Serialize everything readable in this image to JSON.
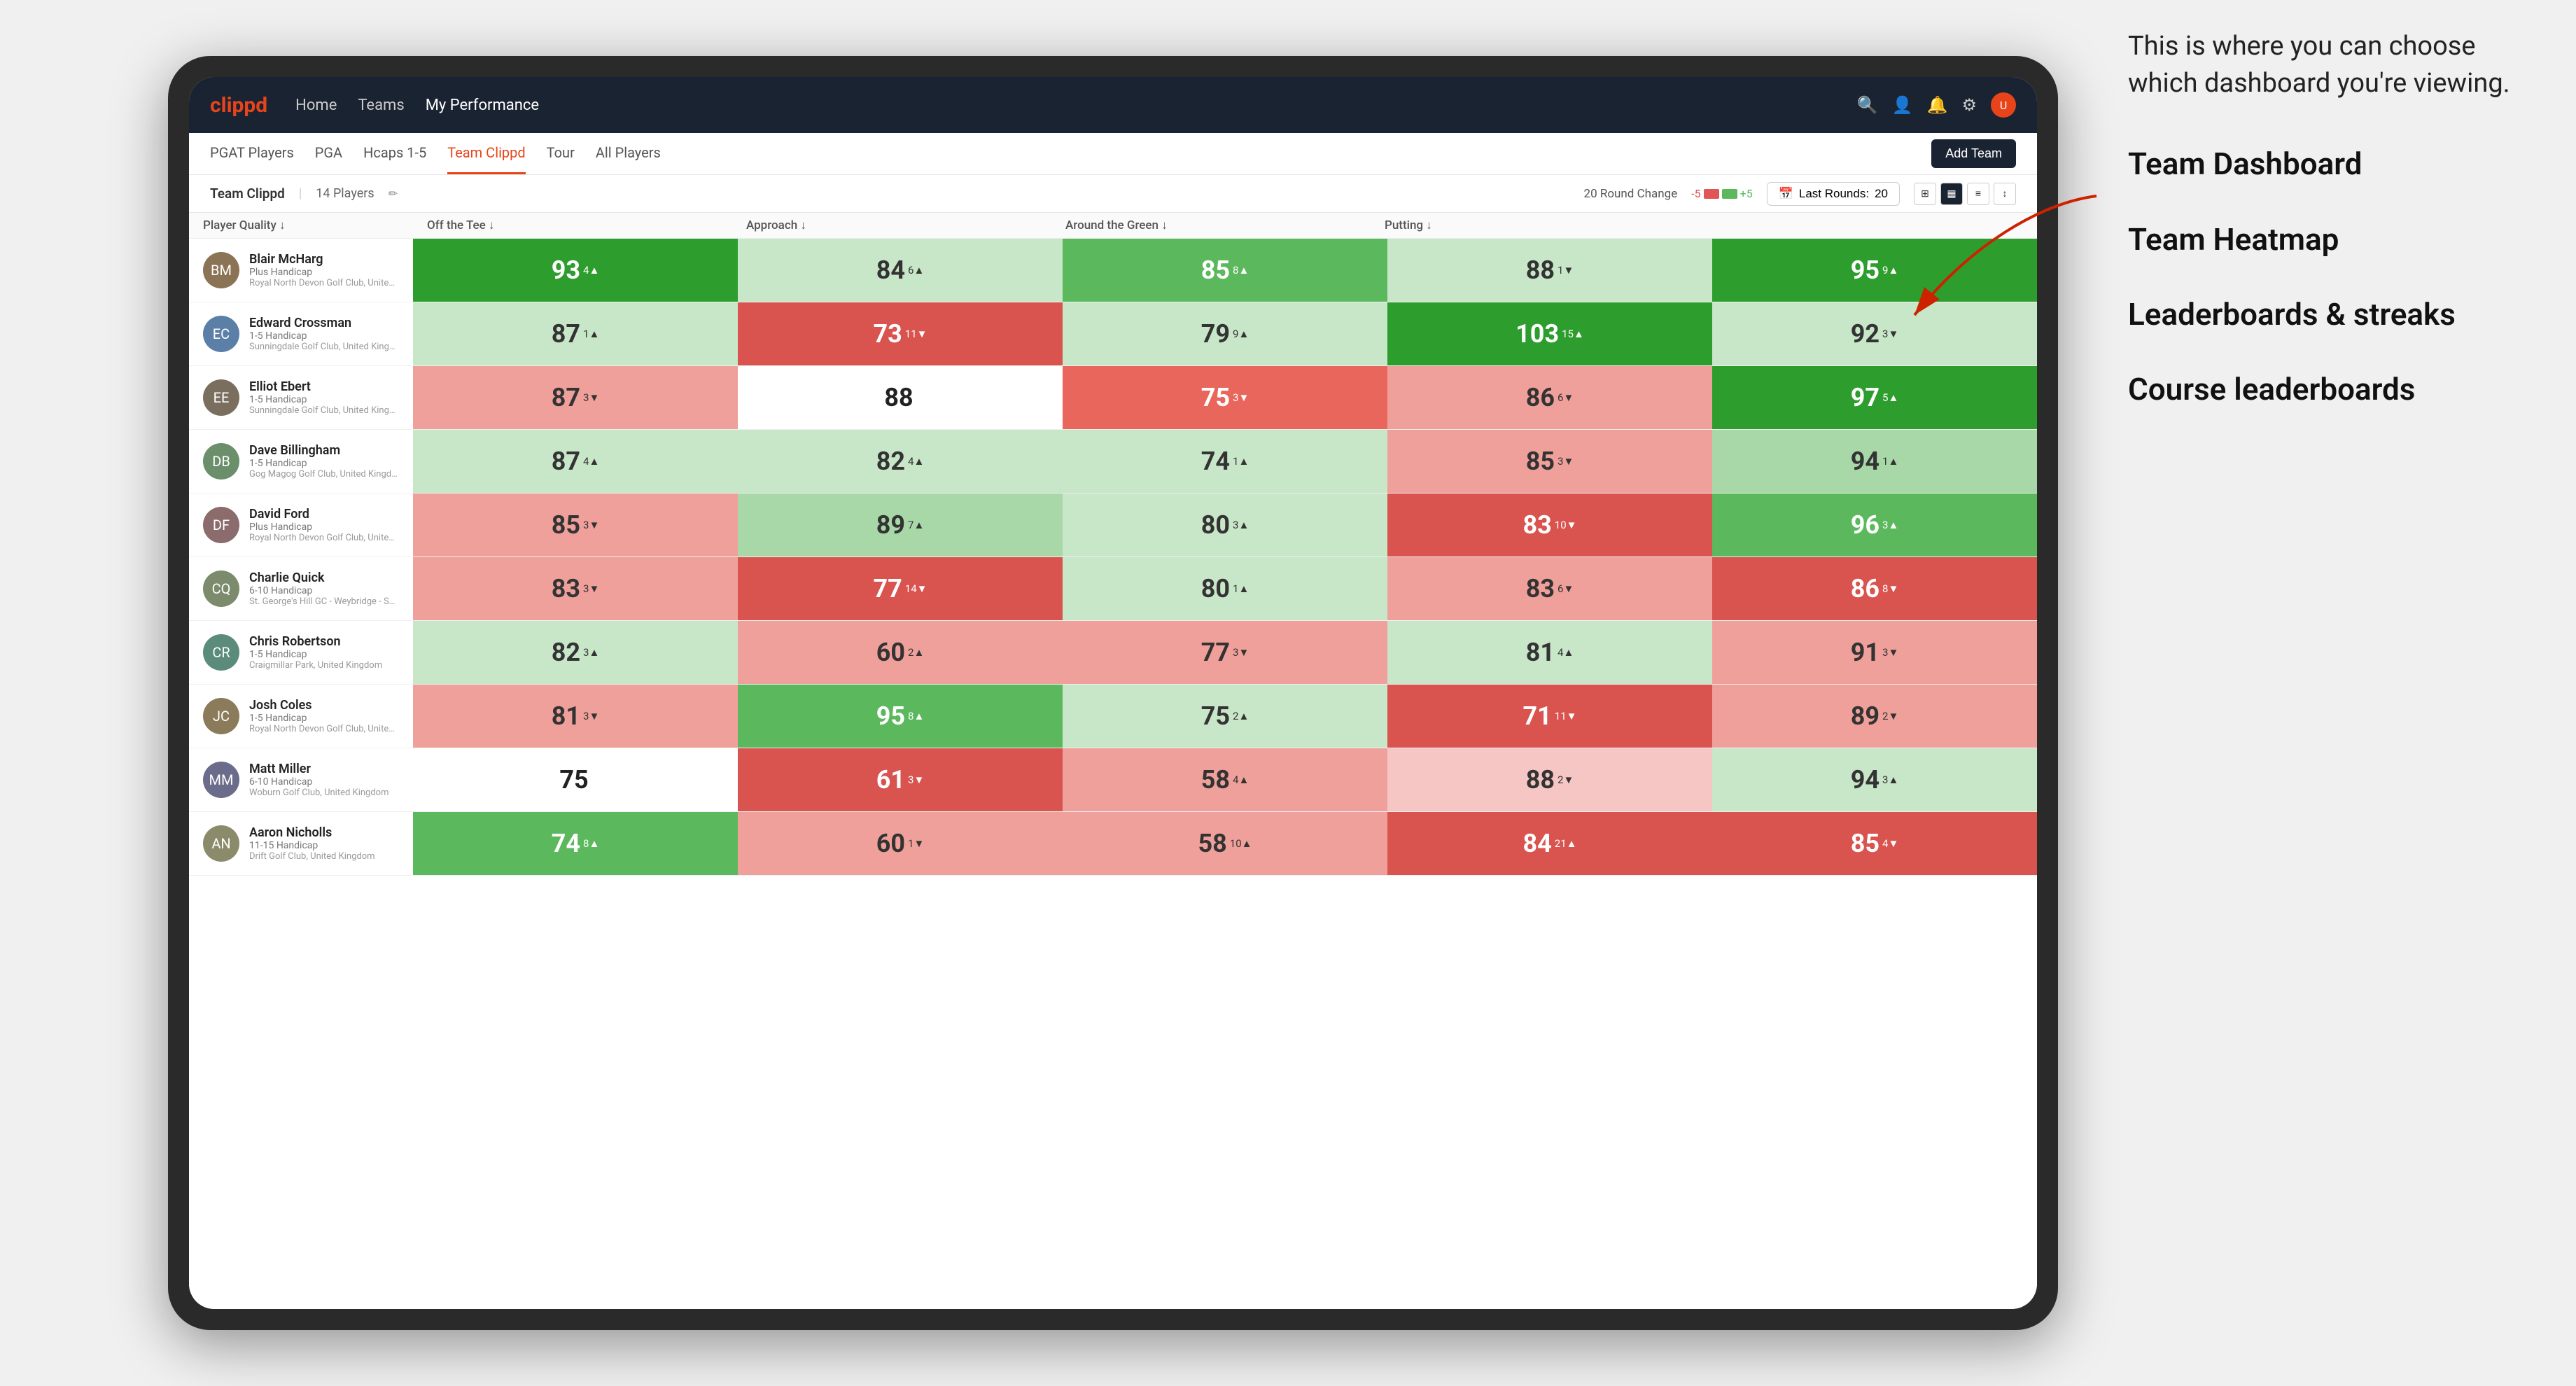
{
  "annotation": {
    "intro_text": "This is where you can choose which dashboard you're viewing.",
    "options": [
      "Team Dashboard",
      "Team Heatmap",
      "Leaderboards & streaks",
      "Course leaderboards"
    ]
  },
  "nav": {
    "logo": "clippd",
    "links": [
      "Home",
      "Teams",
      "My Performance"
    ],
    "active_link": "My Performance"
  },
  "sub_nav": {
    "tabs": [
      "PGAT Players",
      "PGA",
      "Hcaps 1-5",
      "Team Clippd",
      "Tour",
      "All Players"
    ],
    "active_tab": "Team Clippd",
    "add_team_label": "Add Team"
  },
  "team_header": {
    "team_name": "Team Clippd",
    "separator": "|",
    "player_count": "14 Players",
    "round_change_label": "20 Round Change",
    "change_minus": "-5",
    "change_plus": "+5",
    "last_rounds_label": "Last Rounds:",
    "last_rounds_value": "20"
  },
  "table": {
    "columns": [
      "Player Quality ↓",
      "Off the Tee ↓",
      "Approach ↓",
      "Around the Green ↓",
      "Putting ↓"
    ],
    "players": [
      {
        "name": "Blair McHarg",
        "handicap": "Plus Handicap",
        "club": "Royal North Devon Golf Club, United Kingdom",
        "initials": "BM",
        "scores": [
          {
            "value": "93",
            "change": "4",
            "dir": "up",
            "color": "green-dark"
          },
          {
            "value": "84",
            "change": "6",
            "dir": "up",
            "color": "light-green"
          },
          {
            "value": "85",
            "change": "8",
            "dir": "up",
            "color": "green-med"
          },
          {
            "value": "88",
            "change": "1",
            "dir": "down",
            "color": "light-green"
          },
          {
            "value": "95",
            "change": "9",
            "dir": "up",
            "color": "green-dark"
          }
        ]
      },
      {
        "name": "Edward Crossman",
        "handicap": "1-5 Handicap",
        "club": "Sunningdale Golf Club, United Kingdom",
        "initials": "EC",
        "scores": [
          {
            "value": "87",
            "change": "1",
            "dir": "up",
            "color": "light-green"
          },
          {
            "value": "73",
            "change": "11",
            "dir": "down",
            "color": "red-dark"
          },
          {
            "value": "79",
            "change": "9",
            "dir": "up",
            "color": "light-green"
          },
          {
            "value": "103",
            "change": "15",
            "dir": "up",
            "color": "green-dark"
          },
          {
            "value": "92",
            "change": "3",
            "dir": "down",
            "color": "light-green"
          }
        ]
      },
      {
        "name": "Elliot Ebert",
        "handicap": "1-5 Handicap",
        "club": "Sunningdale Golf Club, United Kingdom",
        "initials": "EE",
        "scores": [
          {
            "value": "87",
            "change": "3",
            "dir": "down",
            "color": "red-light"
          },
          {
            "value": "88",
            "change": "",
            "dir": "",
            "color": "neutral"
          },
          {
            "value": "75",
            "change": "3",
            "dir": "down",
            "color": "red-med"
          },
          {
            "value": "86",
            "change": "6",
            "dir": "down",
            "color": "red-light"
          },
          {
            "value": "97",
            "change": "5",
            "dir": "up",
            "color": "green-dark"
          }
        ]
      },
      {
        "name": "Dave Billingham",
        "handicap": "1-5 Handicap",
        "club": "Gog Magog Golf Club, United Kingdom",
        "initials": "DB",
        "scores": [
          {
            "value": "87",
            "change": "4",
            "dir": "up",
            "color": "light-green"
          },
          {
            "value": "82",
            "change": "4",
            "dir": "up",
            "color": "light-green"
          },
          {
            "value": "74",
            "change": "1",
            "dir": "up",
            "color": "light-green"
          },
          {
            "value": "85",
            "change": "3",
            "dir": "down",
            "color": "red-light"
          },
          {
            "value": "94",
            "change": "1",
            "dir": "up",
            "color": "green-light"
          }
        ]
      },
      {
        "name": "David Ford",
        "handicap": "Plus Handicap",
        "club": "Royal North Devon Golf Club, United Kingdom",
        "initials": "DF",
        "scores": [
          {
            "value": "85",
            "change": "3",
            "dir": "down",
            "color": "red-light"
          },
          {
            "value": "89",
            "change": "7",
            "dir": "up",
            "color": "green-light"
          },
          {
            "value": "80",
            "change": "3",
            "dir": "up",
            "color": "light-green"
          },
          {
            "value": "83",
            "change": "10",
            "dir": "down",
            "color": "red-dark"
          },
          {
            "value": "96",
            "change": "3",
            "dir": "up",
            "color": "green-med"
          }
        ]
      },
      {
        "name": "Charlie Quick",
        "handicap": "6-10 Handicap",
        "club": "St. George's Hill GC - Weybridge - Surrey, Uni...",
        "initials": "CQ",
        "scores": [
          {
            "value": "83",
            "change": "3",
            "dir": "down",
            "color": "red-light"
          },
          {
            "value": "77",
            "change": "14",
            "dir": "down",
            "color": "red-dark"
          },
          {
            "value": "80",
            "change": "1",
            "dir": "up",
            "color": "light-green"
          },
          {
            "value": "83",
            "change": "6",
            "dir": "down",
            "color": "red-light"
          },
          {
            "value": "86",
            "change": "8",
            "dir": "down",
            "color": "red-dark"
          }
        ]
      },
      {
        "name": "Chris Robertson",
        "handicap": "1-5 Handicap",
        "club": "Craigmillar Park, United Kingdom",
        "initials": "CR",
        "scores": [
          {
            "value": "82",
            "change": "3",
            "dir": "up",
            "color": "light-green"
          },
          {
            "value": "60",
            "change": "2",
            "dir": "up",
            "color": "red-light"
          },
          {
            "value": "77",
            "change": "3",
            "dir": "down",
            "color": "red-light"
          },
          {
            "value": "81",
            "change": "4",
            "dir": "up",
            "color": "light-green"
          },
          {
            "value": "91",
            "change": "3",
            "dir": "down",
            "color": "red-light"
          }
        ]
      },
      {
        "name": "Josh Coles",
        "handicap": "1-5 Handicap",
        "club": "Royal North Devon Golf Club, United Kingdom",
        "initials": "JC",
        "scores": [
          {
            "value": "81",
            "change": "3",
            "dir": "down",
            "color": "red-light"
          },
          {
            "value": "95",
            "change": "8",
            "dir": "up",
            "color": "green-med"
          },
          {
            "value": "75",
            "change": "2",
            "dir": "up",
            "color": "light-green"
          },
          {
            "value": "71",
            "change": "11",
            "dir": "down",
            "color": "red-dark"
          },
          {
            "value": "89",
            "change": "2",
            "dir": "down",
            "color": "red-light"
          }
        ]
      },
      {
        "name": "Matt Miller",
        "handicap": "6-10 Handicap",
        "club": "Woburn Golf Club, United Kingdom",
        "initials": "MM",
        "scores": [
          {
            "value": "75",
            "change": "",
            "dir": "",
            "color": "neutral"
          },
          {
            "value": "61",
            "change": "3",
            "dir": "down",
            "color": "red-dark"
          },
          {
            "value": "58",
            "change": "4",
            "dir": "up",
            "color": "red-light"
          },
          {
            "value": "88",
            "change": "2",
            "dir": "down",
            "color": "light-red"
          },
          {
            "value": "94",
            "change": "3",
            "dir": "up",
            "color": "light-green"
          }
        ]
      },
      {
        "name": "Aaron Nicholls",
        "handicap": "11-15 Handicap",
        "club": "Drift Golf Club, United Kingdom",
        "initials": "AN",
        "scores": [
          {
            "value": "74",
            "change": "8",
            "dir": "up",
            "color": "green-med"
          },
          {
            "value": "60",
            "change": "1",
            "dir": "down",
            "color": "red-light"
          },
          {
            "value": "58",
            "change": "10",
            "dir": "up",
            "color": "red-light"
          },
          {
            "value": "84",
            "change": "21",
            "dir": "up",
            "color": "red-dark"
          },
          {
            "value": "85",
            "change": "4",
            "dir": "down",
            "color": "red-dark"
          }
        ]
      }
    ]
  }
}
